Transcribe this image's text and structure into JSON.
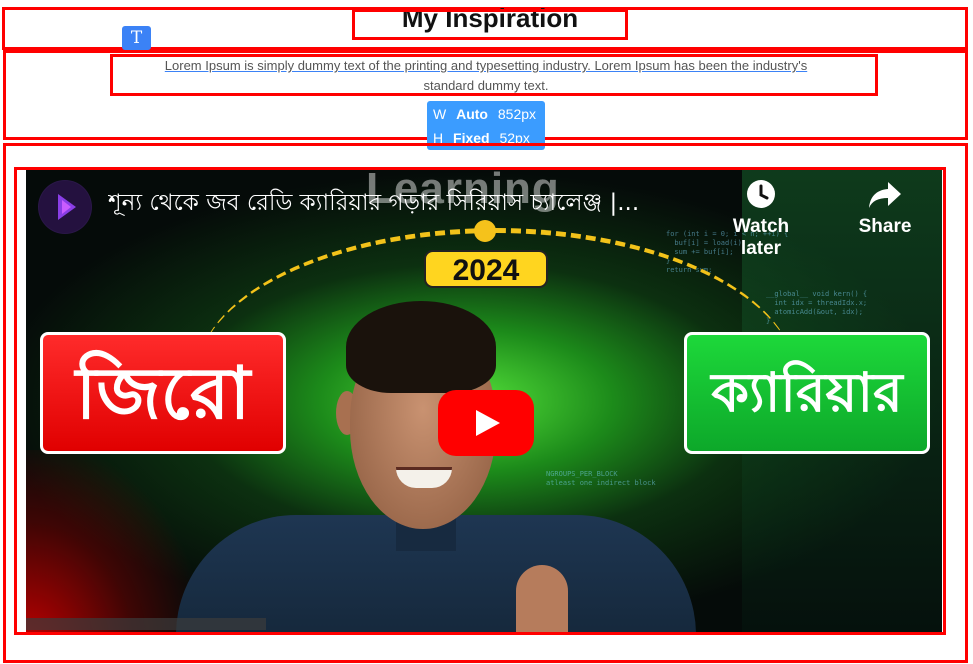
{
  "header": {
    "title": "My Inspiration",
    "text_tool_icon_glyph": "T"
  },
  "description": {
    "line1": "Lorem Ipsum is simply dummy text of the printing and typesetting industry. Lorem Ipsum has been the industry's",
    "line2": "standard dummy text."
  },
  "size_tooltip": {
    "w_label": "W",
    "w_mode": "Auto",
    "w_value": "852px",
    "h_label": "H",
    "h_mode": "Fixed",
    "h_value": "52px"
  },
  "video": {
    "title": "শূন্য থেকে জব রেডি ক্যারিয়ার গড়ার সিরিয়াস চ্যালেঞ্জ |...",
    "watermark": "Learning",
    "watch_later_label": "Watch later",
    "share_label": "Share",
    "year": "2024",
    "left_badge": "জিরো",
    "right_badge": "ক্যারিয়ার",
    "icons": {
      "watch_later": "clock-icon",
      "share": "share-arrow-icon",
      "play": "youtube-play-icon"
    }
  },
  "colors": {
    "selection_outline": "#ff0000",
    "editor_accent": "#3b82f6",
    "badge_red": "#ff2b2b",
    "badge_green": "#1dd83a",
    "year_yellow": "#ffd51f"
  }
}
